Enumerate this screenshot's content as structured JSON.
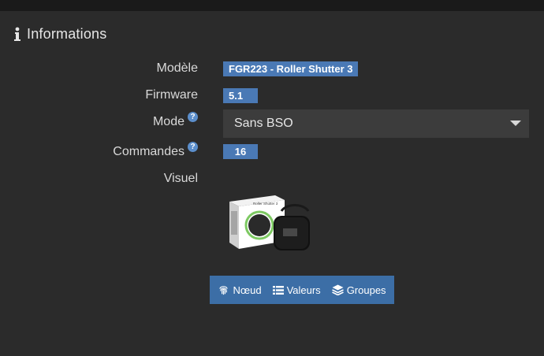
{
  "header": {
    "title": "Informations",
    "icon": "info-icon"
  },
  "fields": {
    "model": {
      "label": "Modèle",
      "value": "FGR223 - Roller Shutter 3"
    },
    "firmware": {
      "label": "Firmware",
      "value": "5.1"
    },
    "mode": {
      "label": "Mode",
      "value": "Sans BSO",
      "help_icon": "?"
    },
    "commands": {
      "label": "Commandes",
      "value": "16",
      "help_icon": "?"
    },
    "visual": {
      "label": "Visuel",
      "box_text": "Roller Shutter 3"
    }
  },
  "buttons": {
    "node": {
      "label": "Nœud",
      "icon": "fingerprint-icon"
    },
    "values": {
      "label": "Valeurs",
      "icon": "list-icon"
    },
    "groups": {
      "label": "Groupes",
      "icon": "layers-icon"
    }
  },
  "colors": {
    "background": "#2b2b2b",
    "badge": "#4a79b5",
    "button_bar": "#3c6ea6",
    "select": "#3c3c3c",
    "help": "#5b8ecb"
  }
}
